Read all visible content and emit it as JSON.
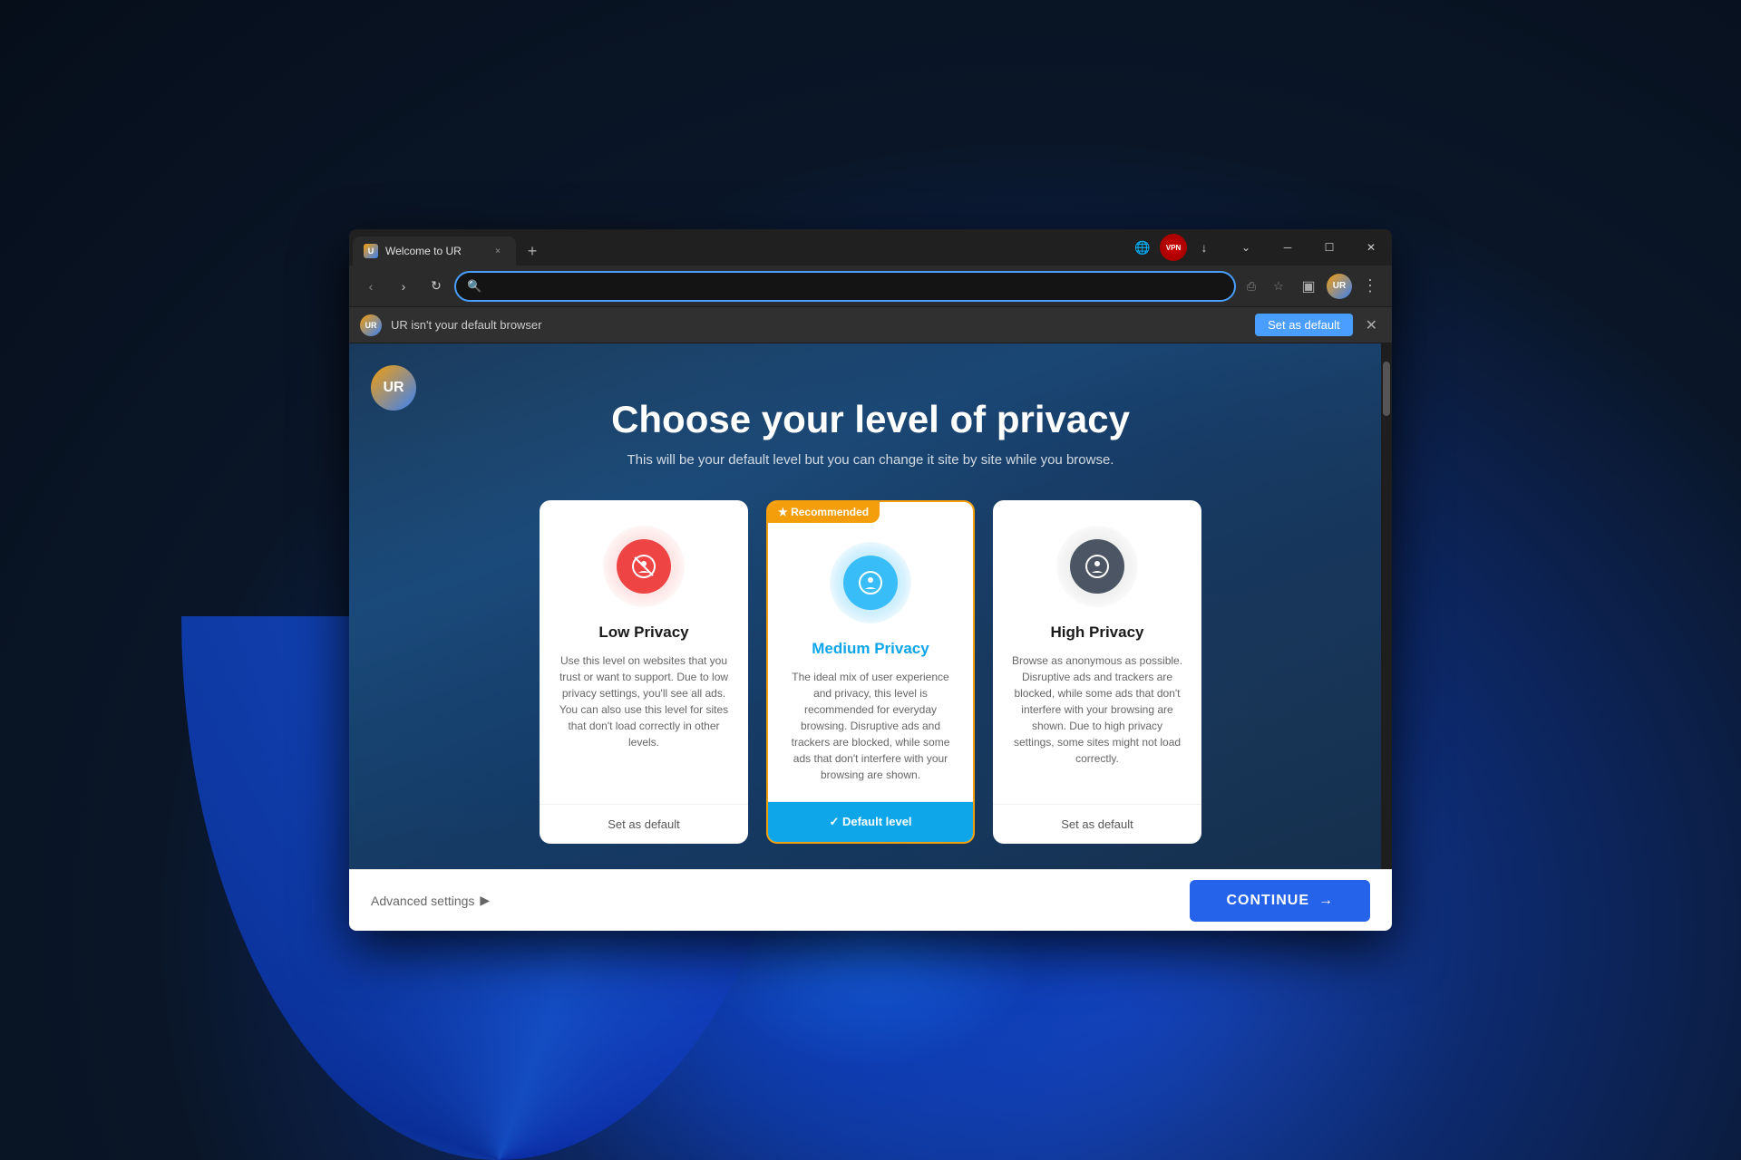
{
  "desktop": {
    "bg_color": "#0d1b2e"
  },
  "browser": {
    "tab": {
      "favicon_text": "U",
      "title": "Welcome to UR",
      "close_label": "×"
    },
    "new_tab_label": "+",
    "toolbar": {
      "vpn_label": "VPN",
      "download_icon": "↓",
      "chevron_icon": "⌄",
      "minimize_icon": "─",
      "maximize_icon": "☐",
      "close_icon": "✕"
    },
    "nav": {
      "back_icon": "‹",
      "forward_icon": "›",
      "reload_icon": "↻",
      "search_placeholder": "",
      "share_icon": "⎙",
      "star_icon": "☆",
      "sidebar_icon": "▣",
      "avatar_text": "UR",
      "menu_icon": "⋮"
    },
    "default_bar": {
      "logo_text": "UR",
      "message": "UR isn't your default browser",
      "button_label": "Set as default",
      "dismiss_label": "✕"
    }
  },
  "page": {
    "logo_text": "UR",
    "title": "Choose your level of privacy",
    "subtitle": "This will be your default level but you can change it site by site while you browse.",
    "cards": [
      {
        "id": "low",
        "icon_color": "red",
        "title": "Low Privacy",
        "description": "Use this level on websites that you trust or want to support. Due to low privacy settings, you'll see all ads. You can also use this level for sites that don't load correctly in other levels.",
        "footer": "Set as default",
        "is_default": false,
        "recommended": false
      },
      {
        "id": "medium",
        "icon_color": "blue",
        "title": "Medium Privacy",
        "description": "The ideal mix of user experience and privacy, this level is recommended for everyday browsing. Disruptive ads and trackers are blocked, while some ads that don't interfere with your browsing are shown.",
        "footer": "✓  Default level",
        "is_default": true,
        "recommended": true,
        "recommended_label": "★  Recommended"
      },
      {
        "id": "high",
        "icon_color": "gray",
        "title": "High Privacy",
        "description": "Browse as anonymous as possible. Disruptive ads and trackers are blocked, while some ads that don't interfere with your browsing are shown. Due to high privacy settings, some sites might not load correctly.",
        "footer": "Set as default",
        "is_default": false,
        "recommended": false
      }
    ],
    "bottom": {
      "advanced_label": "Advanced settings",
      "advanced_arrow": "▶",
      "continue_label": "CONTINUE",
      "continue_arrow": "→"
    }
  }
}
